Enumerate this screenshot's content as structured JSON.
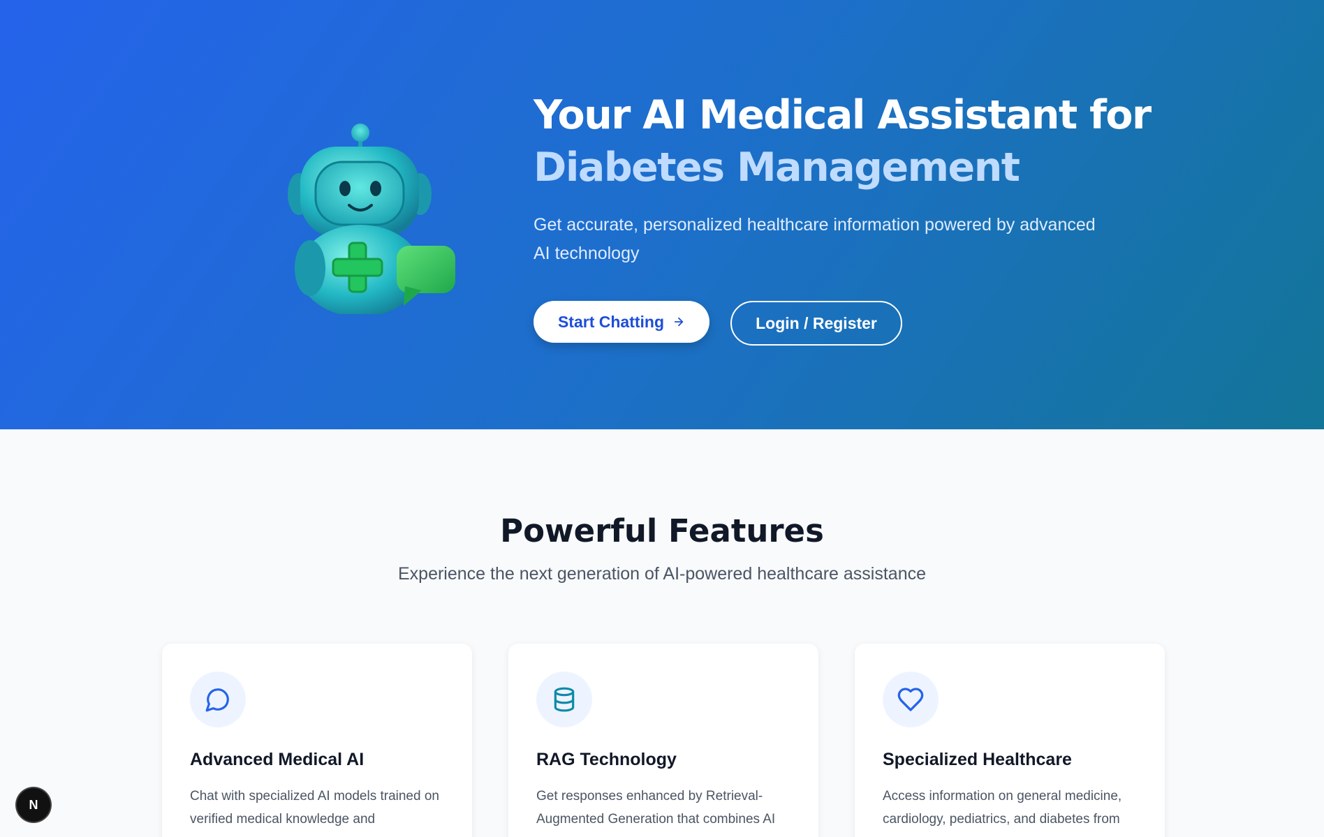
{
  "hero": {
    "title_line1": "Your AI Medical Assistant for",
    "title_line2": "Diabetes Management",
    "subtitle": "Get accurate, personalized healthcare information powered by advanced AI technology",
    "primary_button": "Start Chatting",
    "secondary_button": "Login / Register"
  },
  "features": {
    "title": "Powerful Features",
    "subtitle": "Experience the next generation of AI-powered healthcare assistance",
    "cards": [
      {
        "icon": "chat-bubble-icon",
        "title": "Advanced Medical AI",
        "description": "Chat with specialized AI models trained on verified medical knowledge and"
      },
      {
        "icon": "database-icon",
        "title": "RAG Technology",
        "description": "Get responses enhanced by Retrieval-Augmented Generation that combines AI"
      },
      {
        "icon": "heart-icon",
        "title": "Specialized Healthcare",
        "description": "Access information on general medicine, cardiology, pediatrics, and diabetes from"
      }
    ]
  },
  "dev_badge": {
    "label": "N"
  },
  "colors": {
    "hero_start": "#2563eb",
    "hero_end": "#137598",
    "accent_text": "#bfdbfe",
    "primary_button_text": "#1d4ed8",
    "robot_teal": "#2dd4bf",
    "cross_green": "#22c55e"
  }
}
